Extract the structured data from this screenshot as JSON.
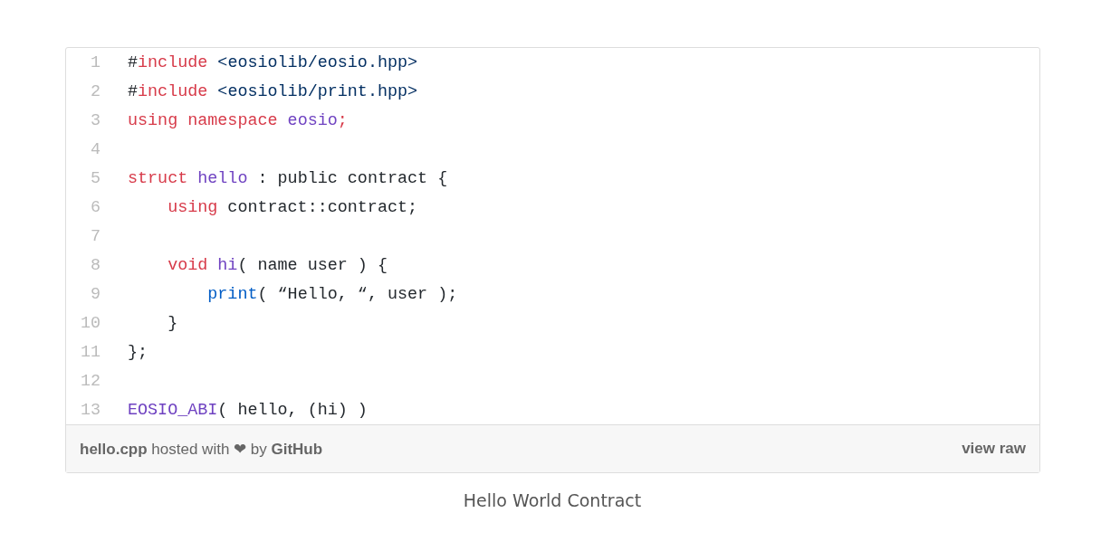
{
  "gist": {
    "lines": [
      {
        "number": "1",
        "tokens": [
          {
            "text": "#",
            "kind": "plain"
          },
          {
            "text": "include",
            "kind": "keyword"
          },
          {
            "text": " <eosiolib/eosio.hpp>",
            "kind": "string"
          }
        ]
      },
      {
        "number": "2",
        "tokens": [
          {
            "text": "#",
            "kind": "plain"
          },
          {
            "text": "include",
            "kind": "keyword"
          },
          {
            "text": " <eosiolib/print.hpp>",
            "kind": "string"
          }
        ]
      },
      {
        "number": "3",
        "tokens": [
          {
            "text": "using namespace ",
            "kind": "keyword"
          },
          {
            "text": "eosio",
            "kind": "entity"
          },
          {
            "text": ";",
            "kind": "keyword"
          }
        ]
      },
      {
        "number": "4"
      },
      {
        "number": "5",
        "tokens": [
          {
            "text": "struct ",
            "kind": "keyword"
          },
          {
            "text": "hello",
            "kind": "entity"
          },
          {
            "text": " : public contract {",
            "kind": "plain"
          }
        ]
      },
      {
        "number": "6",
        "tokens": [
          {
            "text": "    using",
            "kind": "keyword"
          },
          {
            "text": " contract::contract;",
            "kind": "plain"
          }
        ]
      },
      {
        "number": "7"
      },
      {
        "number": "8",
        "tokens": [
          {
            "text": "    void ",
            "kind": "keyword"
          },
          {
            "text": "hi",
            "kind": "entity"
          },
          {
            "text": "( name user ) {",
            "kind": "plain"
          }
        ]
      },
      {
        "number": "9",
        "tokens": [
          {
            "text": "        print",
            "kind": "builtin"
          },
          {
            "text": "( “Hello, “, user );",
            "kind": "plain"
          }
        ]
      },
      {
        "number": "10",
        "tokens": [
          {
            "text": "    }",
            "kind": "plain"
          }
        ]
      },
      {
        "number": "11",
        "tokens": [
          {
            "text": "};",
            "kind": "plain"
          }
        ]
      },
      {
        "number": "12"
      },
      {
        "number": "13",
        "tokens": [
          {
            "text": "EOSIO_ABI",
            "kind": "entity"
          },
          {
            "text": "( hello, (hi) )",
            "kind": "plain"
          }
        ]
      }
    ],
    "footer": {
      "file": "hello.cpp",
      "hosted": "hosted with",
      "heart": "❤",
      "by": "by",
      "host": "GitHub",
      "raw": "view raw"
    }
  },
  "caption": "Hello World Contract"
}
